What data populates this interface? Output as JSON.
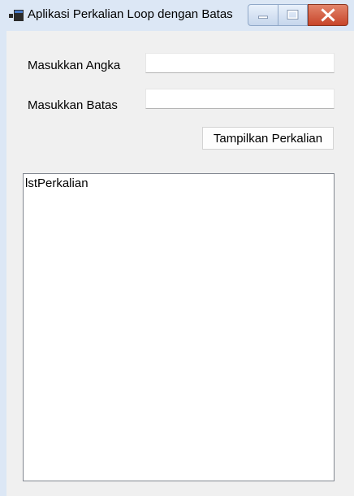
{
  "window": {
    "title": "Aplikasi Perkalian Loop dengan Batas"
  },
  "form": {
    "angka_label": "Masukkan Angka",
    "angka_value": "",
    "batas_label": "Masukkan Batas",
    "batas_value": "",
    "button_label": "Tampilkan Perkalian"
  },
  "list": {
    "items": [
      "lstPerkalian"
    ]
  },
  "colors": {
    "titlebar": "#dce7f5",
    "form_background": "#f0f0f0",
    "close_button": "#c7452a"
  },
  "icons": {
    "app": "app-window-icon",
    "minimize": "minimize-icon",
    "maximize": "maximize-icon",
    "close": "close-icon"
  }
}
